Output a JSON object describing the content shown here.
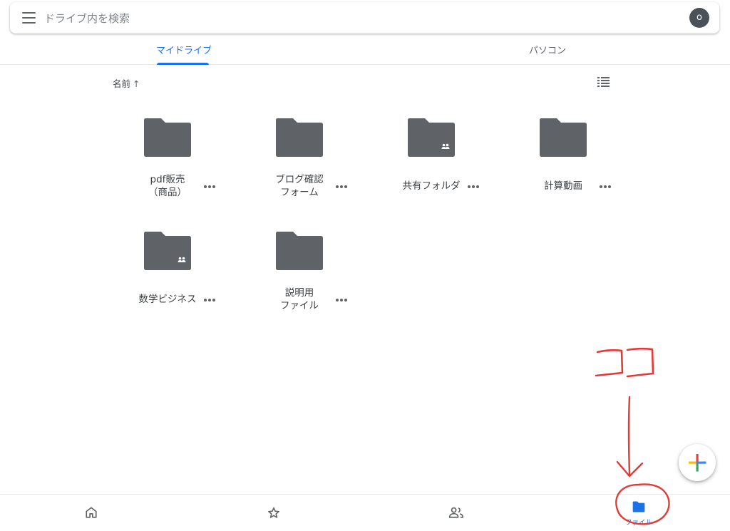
{
  "search": {
    "placeholder": "ドライブ内を検索"
  },
  "account": {
    "initial": "o"
  },
  "tabs": [
    {
      "label": "マイドライブ",
      "active": true
    },
    {
      "label": "パソコン",
      "active": false
    }
  ],
  "sort": {
    "label": "名前",
    "arrow": "↑"
  },
  "folders": [
    {
      "lines": [
        "pdf販売",
        "（商品）"
      ],
      "shared": false
    },
    {
      "lines": [
        "ブログ確認",
        "フォーム"
      ],
      "shared": false
    },
    {
      "lines": [
        "共有フォルダ"
      ],
      "shared": true
    },
    {
      "lines": [
        "計算動画"
      ],
      "shared": false
    },
    {
      "lines": [
        "数学ビジネス"
      ],
      "shared": true
    },
    {
      "lines": [
        "説明用",
        "ファイル"
      ],
      "shared": false
    }
  ],
  "bottom_nav": {
    "items": [
      {
        "icon": "home-icon",
        "label": ""
      },
      {
        "icon": "star-icon",
        "label": ""
      },
      {
        "icon": "shared-people-icon",
        "label": ""
      },
      {
        "icon": "folder-icon",
        "label": "ファイル",
        "active": true
      }
    ]
  },
  "annotation": {
    "text": "ココ",
    "color": "#e53935"
  },
  "colors": {
    "accent": "#1a73e8",
    "folder": "#5f6368",
    "annotation": "#e53935"
  }
}
